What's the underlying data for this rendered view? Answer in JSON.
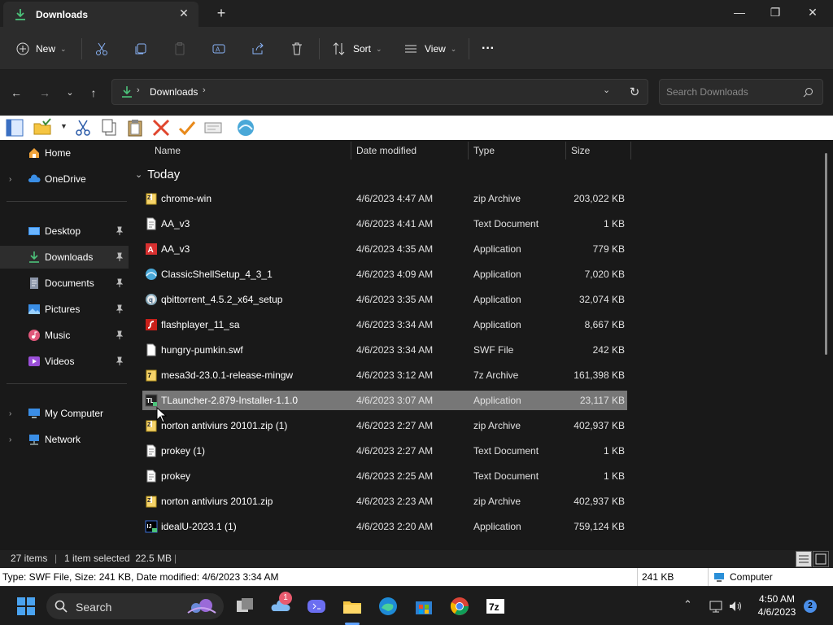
{
  "tab": {
    "title": "Downloads"
  },
  "window_controls": {
    "minimize": "—",
    "maximize": "❐",
    "close": "✕"
  },
  "toolbar": {
    "new_label": "New",
    "sort_label": "Sort",
    "view_label": "View",
    "more": "···"
  },
  "address": {
    "crumb": "Downloads"
  },
  "search": {
    "placeholder": "Search Downloads"
  },
  "sidebar": {
    "items": [
      {
        "label": "Home"
      },
      {
        "label": "OneDrive"
      },
      {
        "label": "Desktop"
      },
      {
        "label": "Downloads"
      },
      {
        "label": "Documents"
      },
      {
        "label": "Pictures"
      },
      {
        "label": "Music"
      },
      {
        "label": "Videos"
      },
      {
        "label": "My Computer"
      },
      {
        "label": "Network"
      }
    ]
  },
  "columns": {
    "name": "Name",
    "date": "Date modified",
    "type": "Type",
    "size": "Size"
  },
  "group": {
    "label": "Today"
  },
  "files": [
    {
      "name": "chrome-win",
      "date": "4/6/2023 4:47 AM",
      "type": "zip Archive",
      "size": "203,022 KB",
      "icon": "zip-icon"
    },
    {
      "name": "AA_v3",
      "date": "4/6/2023 4:41 AM",
      "type": "Text Document",
      "size": "1 KB",
      "icon": "text-file-icon"
    },
    {
      "name": "AA_v3",
      "date": "4/6/2023 4:35 AM",
      "type": "Application",
      "size": "779 KB",
      "icon": "ammyy-icon"
    },
    {
      "name": "ClassicShellSetup_4_3_1",
      "date": "4/6/2023 4:09 AM",
      "type": "Application",
      "size": "7,020 KB",
      "icon": "shell-icon"
    },
    {
      "name": "qbittorrent_4.5.2_x64_setup",
      "date": "4/6/2023 3:35 AM",
      "type": "Application",
      "size": "32,074 KB",
      "icon": "qbittorrent-icon"
    },
    {
      "name": "flashplayer_11_sa",
      "date": "4/6/2023 3:34 AM",
      "type": "Application",
      "size": "8,667 KB",
      "icon": "flash-icon"
    },
    {
      "name": "hungry-pumkin.swf",
      "date": "4/6/2023 3:34 AM",
      "type": "SWF File",
      "size": "242 KB",
      "icon": "blank-file-icon"
    },
    {
      "name": "mesa3d-23.0.1-release-mingw",
      "date": "4/6/2023 3:12 AM",
      "type": "7z Archive",
      "size": "161,398 KB",
      "icon": "7z-icon"
    },
    {
      "name": "TLauncher-2.879-Installer-1.1.0",
      "date": "4/6/2023 3:07 AM",
      "type": "Application",
      "size": "23,117 KB",
      "icon": "tlauncher-icon"
    },
    {
      "name": "norton antiviurs 20101.zip (1)",
      "date": "4/6/2023 2:27 AM",
      "type": "zip Archive",
      "size": "402,937 KB",
      "icon": "zip-icon"
    },
    {
      "name": "prokey (1)",
      "date": "4/6/2023 2:27 AM",
      "type": "Text Document",
      "size": "1 KB",
      "icon": "text-file-icon"
    },
    {
      "name": "prokey",
      "date": "4/6/2023 2:25 AM",
      "type": "Text Document",
      "size": "1 KB",
      "icon": "text-file-icon"
    },
    {
      "name": "norton antiviurs 20101.zip",
      "date": "4/6/2023 2:23 AM",
      "type": "zip Archive",
      "size": "402,937 KB",
      "icon": "zip-icon"
    },
    {
      "name": "idealU-2023.1 (1)",
      "date": "4/6/2023 2:20 AM",
      "type": "Application",
      "size": "759,124 KB",
      "icon": "intellij-icon"
    }
  ],
  "status": {
    "count": "27 items",
    "selected": "1 item selected  22.5 MB",
    "sep": "|"
  },
  "classic_status": {
    "info": "Type: SWF File, Size: 241 KB, Date modified: 4/6/2023 3:34 AM",
    "size": "241 KB",
    "location": "Computer"
  },
  "taskbar": {
    "search_label": "Search",
    "time": "4:50 AM",
    "date": "4/6/2023",
    "notifications": "2",
    "widget_badge": "1"
  },
  "colors": {
    "selected_row": "#777777",
    "accent": "#5ea1ff",
    "download_green": "#4cc27a"
  }
}
